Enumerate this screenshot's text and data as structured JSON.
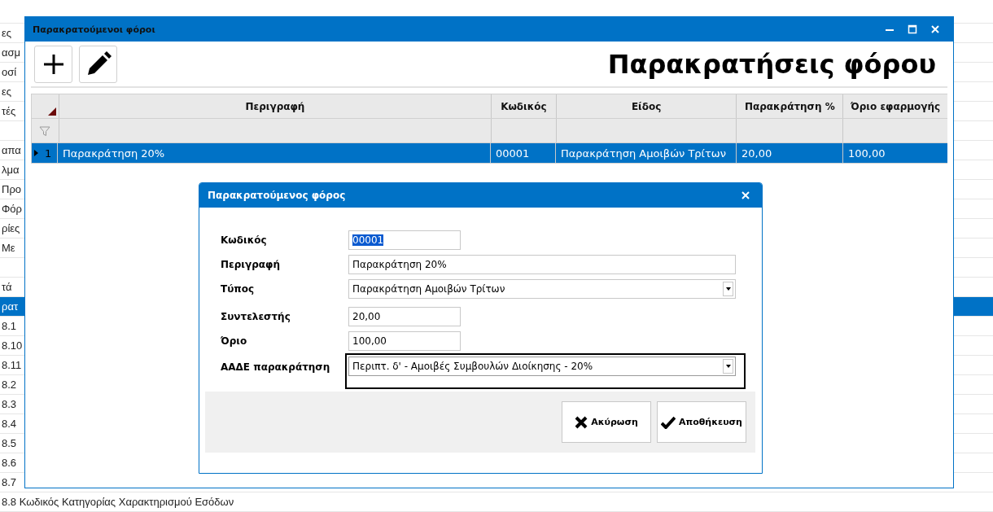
{
  "background_list": [
    {
      "selected": false
    },
    {
      "text": "ες",
      "selected": false
    },
    {
      "text": "ασμ",
      "selected": false
    },
    {
      "text": "οσί",
      "selected": false
    },
    {
      "text": "ες",
      "selected": false
    },
    {
      "text": "τές",
      "selected": false
    },
    {
      "selected": false
    },
    {
      "text": "απα",
      "selected": false
    },
    {
      "text": "λμα",
      "selected": false
    },
    {
      "text": "Προ",
      "selected": false
    },
    {
      "text": "Φόρ",
      "selected": false
    },
    {
      "text": "ρίες",
      "selected": false
    },
    {
      "text": "Με",
      "selected": false
    },
    {
      "selected": false
    },
    {
      "text": "τά",
      "selected": false
    },
    {
      "text": "ρατ",
      "selected": true
    },
    {
      "text": "8.1",
      "selected": false
    },
    {
      "text": "8.10",
      "selected": false
    },
    {
      "text": "8.11",
      "selected": false
    },
    {
      "text": "8.2",
      "selected": false
    },
    {
      "text": "8.3",
      "selected": false
    },
    {
      "text": "8.4",
      "selected": false
    },
    {
      "text": "8.5",
      "selected": false
    },
    {
      "text": "8.6",
      "selected": false
    },
    {
      "text": "8.7",
      "selected": false
    },
    {
      "text": "8.8 Κωδικός Κατηγορίας Χαρακτηρισμού Εσόδων",
      "selected": false
    }
  ],
  "window": {
    "title": "Παρακρατούμενοι φόροι"
  },
  "page_title": "Παρακρατήσεις φόρου",
  "grid": {
    "columns": [
      "Περιγραφή",
      "Κωδικός",
      "Είδος",
      "Παρακράτηση %",
      "Όριο εφαρμογής"
    ],
    "rows": [
      {
        "number": "1",
        "selected": true,
        "cells": [
          "Παρακράτηση 20%",
          "00001",
          "Παρακράτηση Αμοιβών Τρίτων",
          "20,00",
          "100,00"
        ]
      }
    ]
  },
  "dialog": {
    "title": "Παρακρατούμενος φόρος",
    "fields": [
      {
        "label": "Κωδικός",
        "value": "00001",
        "kind": "short",
        "value_selected": true,
        "focused": false
      },
      {
        "label": "Περιγραφή",
        "value": "Παρακράτηση 20%",
        "kind": "text",
        "value_selected": false,
        "focused": false
      },
      {
        "label": "Τύπος",
        "value": "Παρακράτηση Αμοιβών Τρίτων",
        "kind": "combo",
        "value_selected": false,
        "focused": false
      },
      {
        "label": "Συντελεστής",
        "value": "20,00",
        "kind": "short",
        "value_selected": false,
        "focused": false
      },
      {
        "label": "Όριο",
        "value": "100,00",
        "kind": "short",
        "value_selected": false,
        "focused": false
      },
      {
        "label": "ΑΑΔΕ παρακράτηση",
        "value": "Περιπτ. δ' - Αμοιβές Συμβουλών Διοίκησης - 20%",
        "kind": "combo",
        "value_selected": false,
        "focused": true
      }
    ],
    "buttons": [
      {
        "label": "Ακύρωση",
        "kind": "cancel"
      },
      {
        "label": "Αποθήκευση",
        "kind": "save"
      }
    ]
  }
}
